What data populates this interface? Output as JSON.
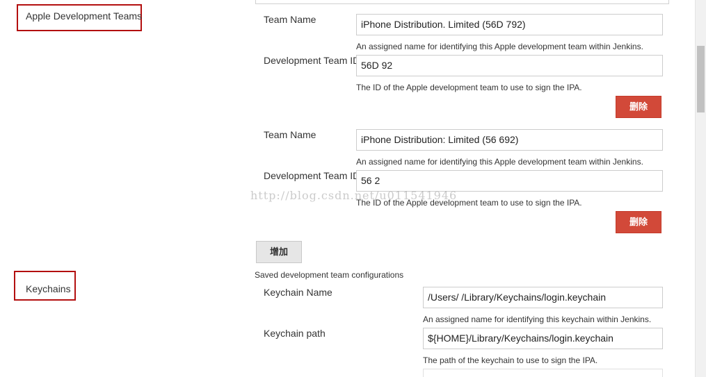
{
  "sections": {
    "apple_teams_label": "Apple Development Teams",
    "keychains_label": "Keychains"
  },
  "teams": [
    {
      "team_name_label": "Team Name",
      "team_name_value": "iPhone Distribution.                                              Limited (56D            792)",
      "team_name_help": "An assigned name for identifying this Apple development team within Jenkins.",
      "team_id_label": "Development Team ID",
      "team_id_value": "56D          92",
      "team_id_help": "The ID of the Apple development team to use to sign the IPA.",
      "delete_label": "删除"
    },
    {
      "team_name_label": "Team Name",
      "team_name_value": "iPhone Distribution:                                              Limited (56            692)",
      "team_name_help": "An assigned name for identifying this Apple development team within Jenkins.",
      "team_id_label": "Development Team ID",
      "team_id_value": "56             2",
      "team_id_help": "The ID of the Apple development team to use to sign the IPA.",
      "delete_label": "删除"
    }
  ],
  "add_label": "增加",
  "saved_configs_text": "Saved development team configurations",
  "keychain": {
    "name_label": "Keychain Name",
    "name_value": "/Users/       /Library/Keychains/login.keychain",
    "name_help": "An assigned name for identifying this keychain within Jenkins.",
    "path_label": "Keychain path",
    "path_value": "${HOME}/Library/Keychains/login.keychain",
    "path_help": "The path of the keychain to use to sign the IPA."
  },
  "watermark": "http://blog.csdn.net/u011541946",
  "colors": {
    "delete_button": "#d24939",
    "highlight_box": "#b30f0f",
    "add_button": "#e6e6e6"
  }
}
